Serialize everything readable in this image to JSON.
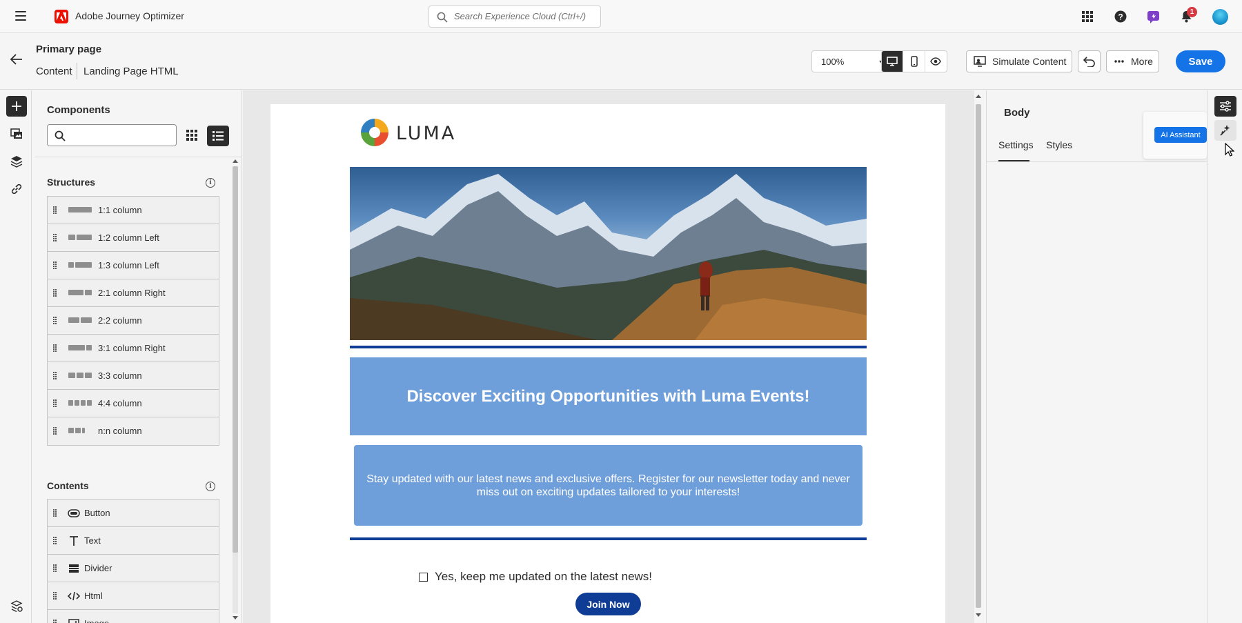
{
  "topbar": {
    "app_title": "Adobe Journey Optimizer",
    "search_placeholder": "Search Experience Cloud (Ctrl+/)",
    "notification_count": "1"
  },
  "pagebar": {
    "page_title": "Primary page",
    "breadcrumb": [
      "Content",
      "Landing Page HTML"
    ],
    "zoom": "100%",
    "simulate_label": "Simulate Content",
    "more_label": "More",
    "save_label": "Save"
  },
  "components": {
    "title": "Components",
    "structures_heading": "Structures",
    "structures": [
      {
        "label": "1:1 column",
        "cols": [
          34
        ]
      },
      {
        "label": "1:2 column Left",
        "cols": [
          10,
          22
        ]
      },
      {
        "label": "1:3 column Left",
        "cols": [
          8,
          24
        ]
      },
      {
        "label": "2:1 column Right",
        "cols": [
          22,
          10
        ]
      },
      {
        "label": "2:2 column",
        "cols": [
          16,
          16
        ]
      },
      {
        "label": "3:1 column Right",
        "cols": [
          24,
          8
        ]
      },
      {
        "label": "3:3 column",
        "cols": [
          10,
          10,
          10
        ]
      },
      {
        "label": "4:4 column",
        "cols": [
          7,
          7,
          7,
          7
        ]
      },
      {
        "label": "n:n column",
        "cols": [
          8,
          8,
          4
        ]
      }
    ],
    "contents_heading": "Contents",
    "contents": [
      {
        "label": "Button",
        "icon": "button-icon"
      },
      {
        "label": "Text",
        "icon": "text-icon"
      },
      {
        "label": "Divider",
        "icon": "divider-icon"
      },
      {
        "label": "Html",
        "icon": "html-icon"
      },
      {
        "label": "Image",
        "icon": "image-icon"
      }
    ]
  },
  "canvas": {
    "logo_text": "LUMA",
    "banner_heading": "Discover Exciting Opportunities with Luma Events!",
    "body_text": "Stay updated with our latest news and exclusive offers. Register for our newsletter today and never miss out on exciting updates tailored to your interests!",
    "checkbox_label": "Yes, keep me updated on the latest news!",
    "cta_label": "Join Now",
    "colors": {
      "banner": "#6f9fdb",
      "divider": "#0f3c94",
      "cta": "#0f3c94"
    }
  },
  "right_panel": {
    "title": "Body",
    "tabs": [
      "Settings",
      "Styles"
    ],
    "active_tab": "Settings",
    "ai_assistant_label": "AI Assistant"
  },
  "colors": {
    "accent": "#1473e6",
    "dark": "#2c2c2c"
  }
}
